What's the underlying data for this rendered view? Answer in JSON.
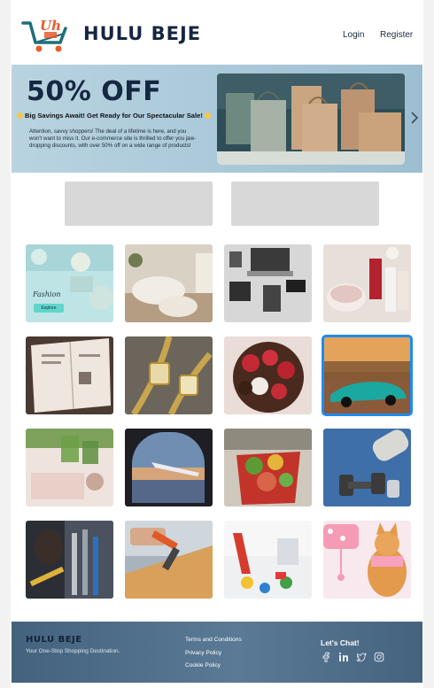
{
  "header": {
    "brand": "HULU BEJE",
    "logo_text": "Uh",
    "nav": {
      "login": "Login",
      "register": "Register"
    }
  },
  "banner": {
    "title": "50% OFF",
    "subtitle": "Big Savings Await! Get Ready for Our Spectacular Sale!",
    "description": "Attention, savvy shoppers! The deal of a lifetime is here, and you won't want to miss it. Our e-commerce site is thrilled to offer you jaw-dropping discounts, with over 50% off on a wide range of products!",
    "next_icon": "chevron-right-icon"
  },
  "tiles": [
    {
      "caption": "Fashion",
      "button": "Explore"
    },
    {},
    {},
    {},
    {},
    {},
    {},
    {},
    {},
    {},
    {},
    {},
    {},
    {},
    {},
    {}
  ],
  "footer": {
    "brand": "HULU BEJE",
    "tagline": "Your One-Stop Shopping Destination.",
    "links": [
      "Terms and Conditions",
      "Privacy Policy",
      "Cookie Policy"
    ],
    "chat_title": "Let's Chat!",
    "social": [
      "facebook-icon",
      "linkedin-icon",
      "twitter-icon",
      "instagram-icon"
    ]
  },
  "colors": {
    "brand_navy": "#17263f",
    "banner_bg": "#a9c8d9",
    "selected_outline": "#1e8cf0",
    "footer_bg": "#4f6f8c",
    "placeholder": "#d8d8d8"
  }
}
